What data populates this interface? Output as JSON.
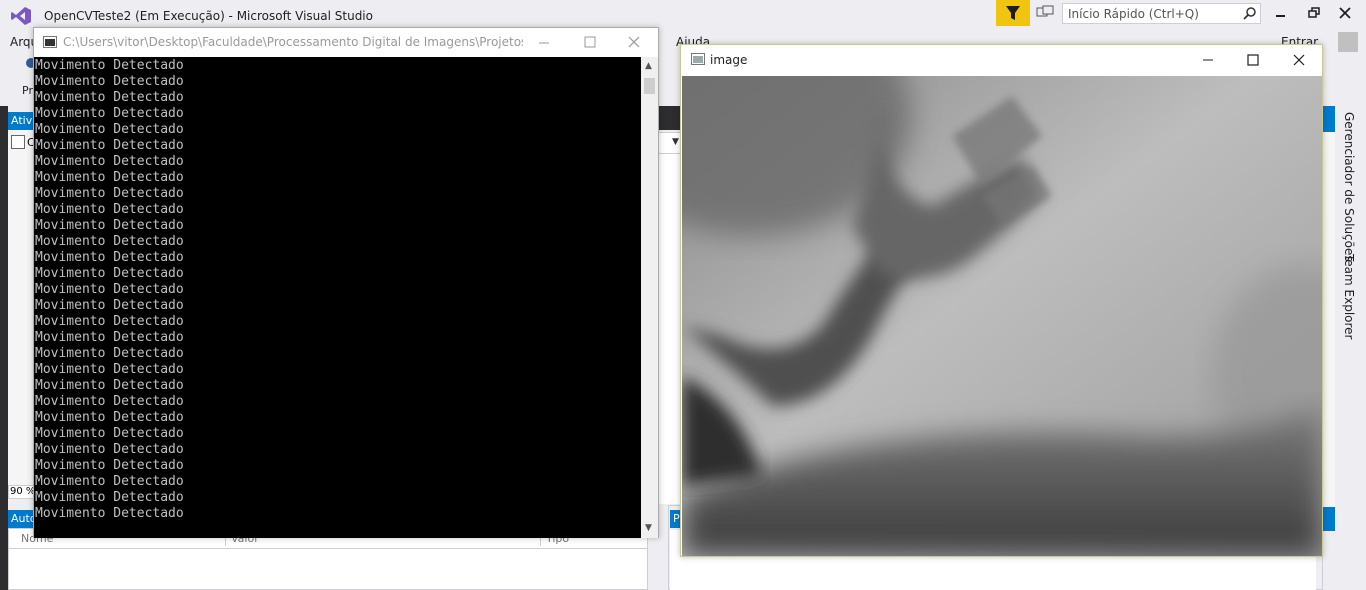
{
  "vs": {
    "title": "OpenCVTeste2 (Em Execução) - Microsoft Visual Studio",
    "quick_launch_placeholder": "Início Rápido (Ctrl+Q)",
    "menu": {
      "arquivo_partial": "Arqu",
      "ajuda": "Ajuda",
      "entrar": "Entrar"
    },
    "toolbar": {
      "pr_partial": "Pr"
    },
    "left_tab_partial": "Ativ",
    "left_c_partial": "C",
    "zoom": "90 %",
    "autos_tab_partial": "Auto",
    "autos_columns": [
      "Nome",
      "Valor",
      "Tipo"
    ],
    "bottom_right_tab_partial": "P",
    "right_tabs": [
      "Gerenciador de Soluções",
      "Team Explorer"
    ],
    "accent_color": "#007acc",
    "filter_color": "#f1c40f"
  },
  "console": {
    "title": "C:\\Users\\vitor\\Desktop\\Faculdade\\Processamento Digital de Imagens\\Projetos\\Ope...",
    "line_text": "Movimento Detectado",
    "line_count": 29,
    "text_color": "#c0c0c0",
    "background": "#000000"
  },
  "image_window": {
    "title": "image",
    "content": "grayscale-blurred-waving-hand"
  }
}
